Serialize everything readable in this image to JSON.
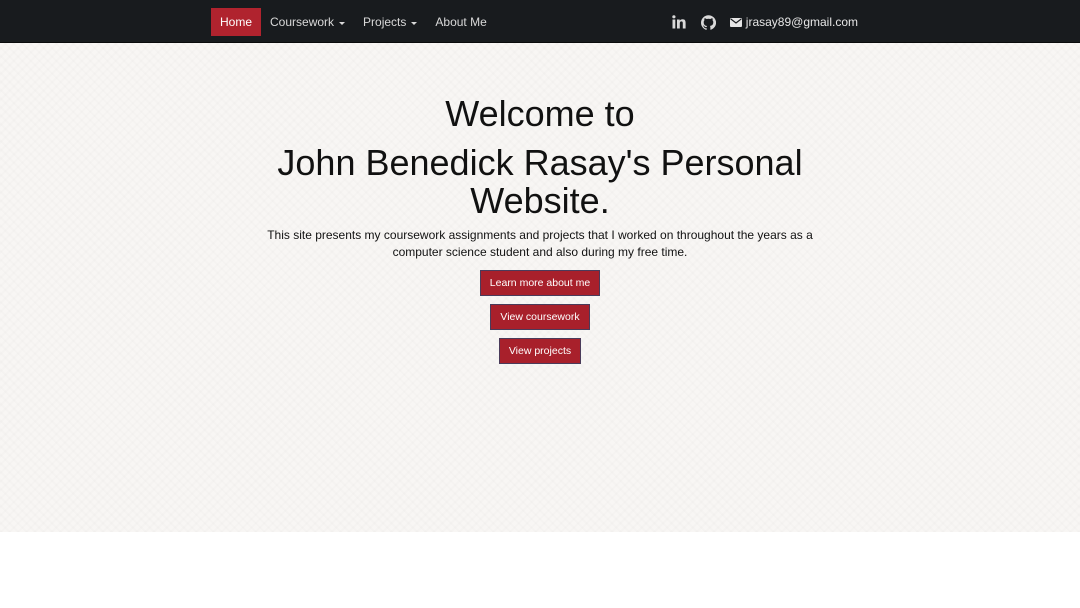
{
  "nav": {
    "items": [
      {
        "label": "Home",
        "active": true
      },
      {
        "label": "Coursework",
        "dropdown": true
      },
      {
        "label": "Projects",
        "dropdown": true
      },
      {
        "label": "About Me"
      }
    ],
    "icons": [
      "linkedin-icon",
      "github-icon",
      "envelope-icon"
    ],
    "email": "jrasay89@gmail.com"
  },
  "hero": {
    "welcome": "Welcome to",
    "headline": "John Benedick Rasay's Personal Website.",
    "intro": "This site presents my coursework assignments and projects that I worked on throughout the years as a computer science student and also during my free time.",
    "buttons": {
      "about": "Learn more about me",
      "coursework": "View coursework",
      "projects": "View projects"
    }
  },
  "colors": {
    "navbar_bg": "#181b1e",
    "accent": "#b0232e",
    "hero_bg": "#f8f6f4"
  }
}
